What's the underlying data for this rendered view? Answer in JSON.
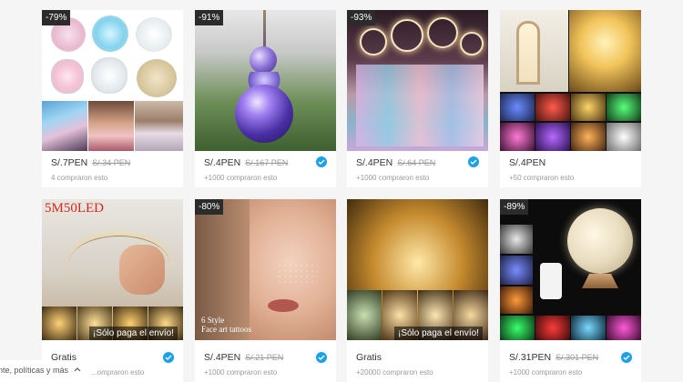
{
  "products": [
    {
      "discount": "-79%",
      "price": "S/.7PEN",
      "old_price": "S/.34 PEN",
      "buyers": "4 compraron esto",
      "verified": false,
      "overlay": "",
      "image": "glitter-makeup",
      "image_caption": ""
    },
    {
      "discount": "-91%",
      "price": "S/.4PEN",
      "old_price": "S/.167 PEN",
      "buyers": "+1000 compraron esto",
      "verified": true,
      "overlay": "",
      "image": "purple-crystal-suncatcher",
      "image_caption": ""
    },
    {
      "discount": "-93%",
      "price": "S/.4PEN",
      "old_price": "S/.64 PEN",
      "buyers": "+1000 compraron esto",
      "verified": true,
      "overlay": "",
      "image": "led-dreamcatchers",
      "image_caption": ""
    },
    {
      "discount": "",
      "price": "S/.4PEN",
      "old_price": "",
      "buyers": "+50 compraron esto",
      "verified": false,
      "overlay": "",
      "image": "fairy-string-lights-colors",
      "image_caption": ""
    },
    {
      "discount": "",
      "price": "Gratis",
      "old_price": "",
      "buyers": "...ompraron esto",
      "verified": true,
      "overlay": "¡Sólo paga el envío!",
      "image": "5m50led-string-lights",
      "image_caption": "5M50LED"
    },
    {
      "discount": "-80%",
      "price": "S/.4PEN",
      "old_price": "S/.21 PEN",
      "buyers": "+1000 compraron esto",
      "verified": true,
      "overlay": "",
      "image": "face-art-tattoos",
      "image_caption": "6 Style\nFace art tattoos"
    },
    {
      "discount": "",
      "price": "Gratis",
      "old_price": "",
      "buyers": "+20000 compraron esto",
      "verified": false,
      "overlay": "¡Sólo paga el envío!",
      "image": "copper-wire-lights",
      "image_caption": ""
    },
    {
      "discount": "-89%",
      "price": "S/.31PEN",
      "old_price": "S/.301 PEN",
      "buyers": "+1000 compraron esto",
      "verified": true,
      "overlay": "",
      "image": "3d-moon-lamp",
      "image_caption": ""
    }
  ],
  "footer": {
    "link_text": "nte, políticas y más"
  },
  "colors": {
    "accent": "#1aa1e6",
    "discount_bg": "#2b2b2b",
    "page_bg": "#f5f5f5"
  }
}
